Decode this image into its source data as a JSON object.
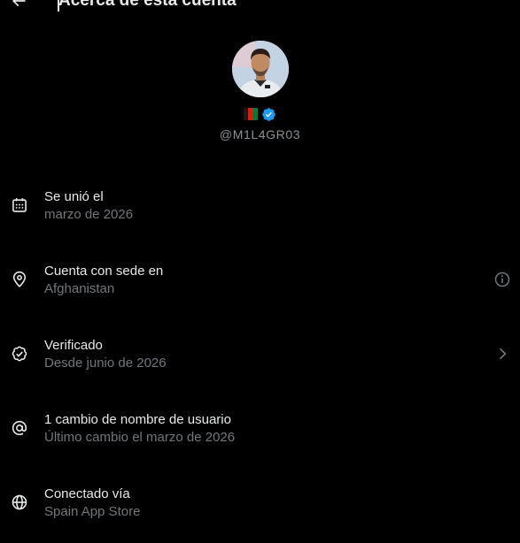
{
  "header": {
    "title": "Acerca de esta cuenta",
    "back_icon": "arrow-left-icon"
  },
  "profile": {
    "handle": "@M1L4GR03",
    "flag_icon": "afghanistan-flag-icon",
    "verified_icon": "verified-badge-icon",
    "accent_color": "#1d9bf0"
  },
  "rows": [
    {
      "icon": "calendar-icon",
      "title": "Se unió el",
      "subtitle": "marzo de 2026"
    },
    {
      "icon": "location-pin-icon",
      "title": "Cuenta con sede en",
      "subtitle": "Afghanistan",
      "action_icon": "info-icon"
    },
    {
      "icon": "verified-check-icon",
      "title": "Verificado",
      "subtitle": "Desde junio de 2026",
      "action_icon": "chevron-right-icon"
    },
    {
      "icon": "at-sign-icon",
      "title": "1 cambio de nombre de usuario",
      "subtitle": "Último cambio el marzo de 2026"
    },
    {
      "icon": "globe-icon",
      "title": "Conectado vía",
      "subtitle": "Spain App Store"
    }
  ]
}
